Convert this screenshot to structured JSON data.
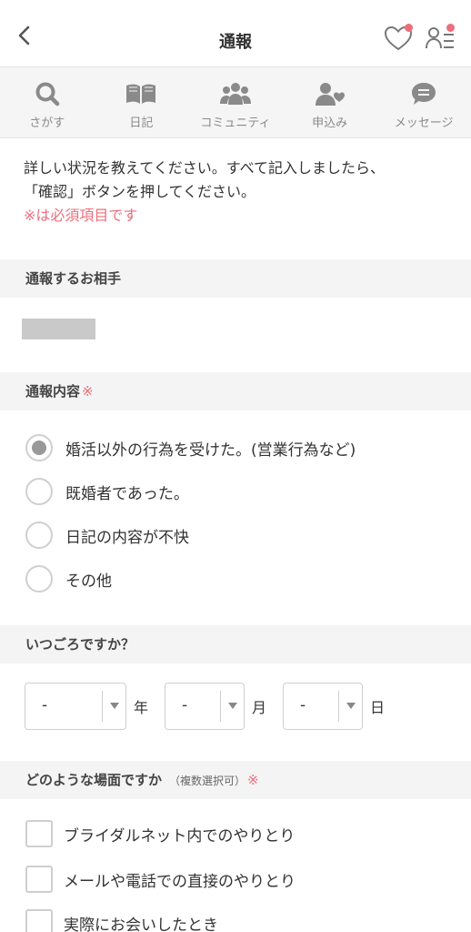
{
  "header": {
    "title": "通報",
    "back_icon": "chevron-left-icon",
    "favorite_icon": "heart-icon",
    "list_icon": "user-list-icon",
    "badge_color": "#ec6e7c"
  },
  "nav": {
    "items": [
      {
        "label": "さがす",
        "icon": "search-icon"
      },
      {
        "label": "日記",
        "icon": "book-icon"
      },
      {
        "label": "コミュニティ",
        "icon": "community-icon"
      },
      {
        "label": "申込み",
        "icon": "person-heart-icon"
      },
      {
        "label": "メッセージ",
        "icon": "chat-icon"
      }
    ]
  },
  "intro": {
    "line1": "詳しい状況を教えてください。すべて記入しましたら、",
    "line2": "「確認」ボタンを押してください。",
    "required_note": "※は必須項目です"
  },
  "target_section": {
    "title": "通報するお相手"
  },
  "content_section": {
    "title": "通報内容",
    "required_mark": "※",
    "options": [
      {
        "label": "婚活以外の行為を受けた。(営業行為など)",
        "checked": true
      },
      {
        "label": "既婚者であった。",
        "checked": false
      },
      {
        "label": "日記の内容が不快",
        "checked": false
      },
      {
        "label": "その他",
        "checked": false
      }
    ]
  },
  "date_section": {
    "title": "いつごろですか？",
    "year": {
      "value": "-",
      "unit": "年"
    },
    "month": {
      "value": "-",
      "unit": "月"
    },
    "day": {
      "value": "-",
      "unit": "日"
    }
  },
  "scene_section": {
    "title": "どのような場面ですか",
    "note": "（複数選択可）",
    "required_mark": "※",
    "options": [
      {
        "label": "ブライダルネット内でのやりとり",
        "checked": false
      },
      {
        "label": "メールや電話での直接のやりとり",
        "checked": false
      },
      {
        "label": "実際にお会いしたとき",
        "checked": false
      }
    ]
  },
  "colors": {
    "accent": "#ec6e7c",
    "nav_icon": "#8a8a8a",
    "section_bg": "#f4f4f4"
  }
}
